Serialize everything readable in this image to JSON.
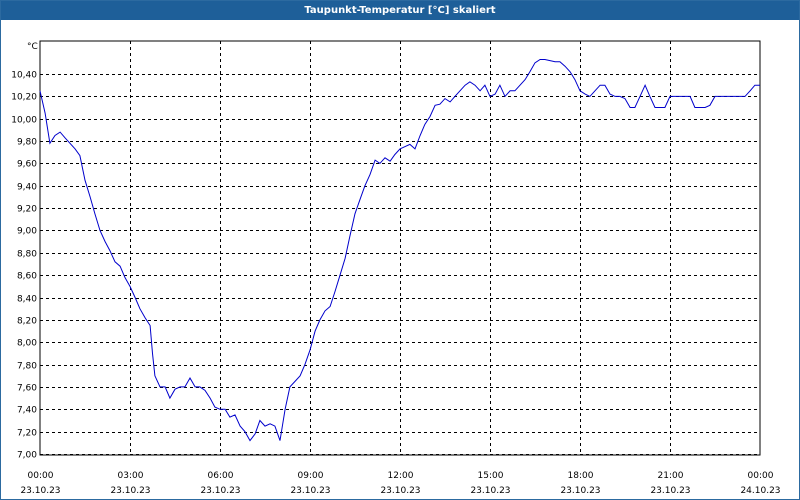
{
  "window": {
    "title": "Taupunkt-Temperatur [°C] skaliert",
    "title_bar_color": "#1e5f99"
  },
  "chart_data": {
    "type": "line",
    "title": "Taupunkt-Temperatur [°C] skaliert",
    "ylabel": "°C",
    "xlabel": "",
    "ylim": [
      7.0,
      10.5
    ],
    "xlim": [
      0,
      24
    ],
    "grid": true,
    "line_color": "#0000cc",
    "yticks": [
      "10,40",
      "10,20",
      "10,00",
      "9,80",
      "9,60",
      "9,40",
      "9,20",
      "9,00",
      "8,80",
      "8,60",
      "8,40",
      "8,20",
      "8,00",
      "7,80",
      "7,60",
      "7,40",
      "7,20",
      "7,00"
    ],
    "ytick_values": [
      10.4,
      10.2,
      10.0,
      9.8,
      9.6,
      9.4,
      9.2,
      9.0,
      8.8,
      8.6,
      8.4,
      8.2,
      8.0,
      7.8,
      7.6,
      7.4,
      7.2,
      7.0
    ],
    "xticks": [
      {
        "time": "00:00",
        "date": "23.10.23",
        "hour": 0
      },
      {
        "time": "03:00",
        "date": "23.10.23",
        "hour": 3
      },
      {
        "time": "06:00",
        "date": "23.10.23",
        "hour": 6
      },
      {
        "time": "09:00",
        "date": "23.10.23",
        "hour": 9
      },
      {
        "time": "12:00",
        "date": "23.10.23",
        "hour": 12
      },
      {
        "time": "15:00",
        "date": "23.10.23",
        "hour": 15
      },
      {
        "time": "18:00",
        "date": "23.10.23",
        "hour": 18
      },
      {
        "time": "21:00",
        "date": "23.10.23",
        "hour": 21
      },
      {
        "time": "00:00",
        "date": "24.10.23",
        "hour": 24
      }
    ],
    "series": [
      {
        "points": [
          [
            0.0,
            10.25
          ],
          [
            0.17,
            10.05
          ],
          [
            0.33,
            9.78
          ],
          [
            0.5,
            9.85
          ],
          [
            0.67,
            9.88
          ],
          [
            0.83,
            9.83
          ],
          [
            1.0,
            9.78
          ],
          [
            1.17,
            9.73
          ],
          [
            1.33,
            9.67
          ],
          [
            1.5,
            9.45
          ],
          [
            1.67,
            9.3
          ],
          [
            1.83,
            9.15
          ],
          [
            2.0,
            9.0
          ],
          [
            2.17,
            8.9
          ],
          [
            2.33,
            8.82
          ],
          [
            2.5,
            8.72
          ],
          [
            2.67,
            8.68
          ],
          [
            2.83,
            8.58
          ],
          [
            3.0,
            8.5
          ],
          [
            3.17,
            8.4
          ],
          [
            3.33,
            8.3
          ],
          [
            3.5,
            8.22
          ],
          [
            3.67,
            8.15
          ],
          [
            3.75,
            7.9
          ],
          [
            3.83,
            7.7
          ],
          [
            4.0,
            7.6
          ],
          [
            4.17,
            7.6
          ],
          [
            4.33,
            7.5
          ],
          [
            4.5,
            7.58
          ],
          [
            4.67,
            7.6
          ],
          [
            4.83,
            7.6
          ],
          [
            5.0,
            7.68
          ],
          [
            5.17,
            7.6
          ],
          [
            5.33,
            7.6
          ],
          [
            5.5,
            7.57
          ],
          [
            5.67,
            7.5
          ],
          [
            5.83,
            7.42
          ],
          [
            6.0,
            7.4
          ],
          [
            6.17,
            7.4
          ],
          [
            6.33,
            7.33
          ],
          [
            6.5,
            7.35
          ],
          [
            6.67,
            7.25
          ],
          [
            6.83,
            7.2
          ],
          [
            7.0,
            7.12
          ],
          [
            7.17,
            7.18
          ],
          [
            7.33,
            7.3
          ],
          [
            7.5,
            7.25
          ],
          [
            7.67,
            7.27
          ],
          [
            7.83,
            7.25
          ],
          [
            8.0,
            7.12
          ],
          [
            8.17,
            7.4
          ],
          [
            8.33,
            7.6
          ],
          [
            8.5,
            7.65
          ],
          [
            8.67,
            7.7
          ],
          [
            8.83,
            7.8
          ],
          [
            9.0,
            7.93
          ],
          [
            9.17,
            8.1
          ],
          [
            9.33,
            8.2
          ],
          [
            9.5,
            8.28
          ],
          [
            9.67,
            8.32
          ],
          [
            9.83,
            8.45
          ],
          [
            10.0,
            8.6
          ],
          [
            10.17,
            8.75
          ],
          [
            10.33,
            8.95
          ],
          [
            10.5,
            9.15
          ],
          [
            10.67,
            9.28
          ],
          [
            10.83,
            9.4
          ],
          [
            11.0,
            9.5
          ],
          [
            11.17,
            9.63
          ],
          [
            11.33,
            9.6
          ],
          [
            11.5,
            9.65
          ],
          [
            11.67,
            9.62
          ],
          [
            11.83,
            9.68
          ],
          [
            12.0,
            9.73
          ],
          [
            12.17,
            9.75
          ],
          [
            12.33,
            9.77
          ],
          [
            12.5,
            9.73
          ],
          [
            12.67,
            9.85
          ],
          [
            12.83,
            9.95
          ],
          [
            13.0,
            10.02
          ],
          [
            13.17,
            10.12
          ],
          [
            13.33,
            10.13
          ],
          [
            13.5,
            10.18
          ],
          [
            13.67,
            10.15
          ],
          [
            13.83,
            10.2
          ],
          [
            14.0,
            10.25
          ],
          [
            14.17,
            10.3
          ],
          [
            14.33,
            10.33
          ],
          [
            14.5,
            10.3
          ],
          [
            14.67,
            10.25
          ],
          [
            14.83,
            10.3
          ],
          [
            15.0,
            10.2
          ],
          [
            15.17,
            10.22
          ],
          [
            15.33,
            10.3
          ],
          [
            15.5,
            10.2
          ],
          [
            15.67,
            10.25
          ],
          [
            15.83,
            10.25
          ],
          [
            16.0,
            10.3
          ],
          [
            16.17,
            10.35
          ],
          [
            16.33,
            10.42
          ],
          [
            16.5,
            10.5
          ],
          [
            16.67,
            10.53
          ],
          [
            16.83,
            10.53
          ],
          [
            17.0,
            10.52
          ],
          [
            17.17,
            10.51
          ],
          [
            17.33,
            10.51
          ],
          [
            17.5,
            10.47
          ],
          [
            17.67,
            10.42
          ],
          [
            17.83,
            10.35
          ],
          [
            18.0,
            10.25
          ],
          [
            18.17,
            10.22
          ],
          [
            18.33,
            10.2
          ],
          [
            18.5,
            10.25
          ],
          [
            18.67,
            10.3
          ],
          [
            18.83,
            10.3
          ],
          [
            19.0,
            10.22
          ],
          [
            19.17,
            10.2
          ],
          [
            19.33,
            10.2
          ],
          [
            19.5,
            10.18
          ],
          [
            19.67,
            10.1
          ],
          [
            19.83,
            10.1
          ],
          [
            20.0,
            10.2
          ],
          [
            20.17,
            10.3
          ],
          [
            20.33,
            10.2
          ],
          [
            20.5,
            10.1
          ],
          [
            20.67,
            10.1
          ],
          [
            20.83,
            10.1
          ],
          [
            21.0,
            10.2
          ],
          [
            21.17,
            10.2
          ],
          [
            21.33,
            10.2
          ],
          [
            21.5,
            10.2
          ],
          [
            21.67,
            10.2
          ],
          [
            21.83,
            10.1
          ],
          [
            22.0,
            10.1
          ],
          [
            22.17,
            10.1
          ],
          [
            22.33,
            10.12
          ],
          [
            22.5,
            10.2
          ],
          [
            22.67,
            10.2
          ],
          [
            22.83,
            10.2
          ],
          [
            23.0,
            10.2
          ],
          [
            23.17,
            10.2
          ],
          [
            23.33,
            10.2
          ],
          [
            23.5,
            10.2
          ],
          [
            23.67,
            10.25
          ],
          [
            23.83,
            10.3
          ],
          [
            24.0,
            10.3
          ]
        ]
      }
    ]
  }
}
